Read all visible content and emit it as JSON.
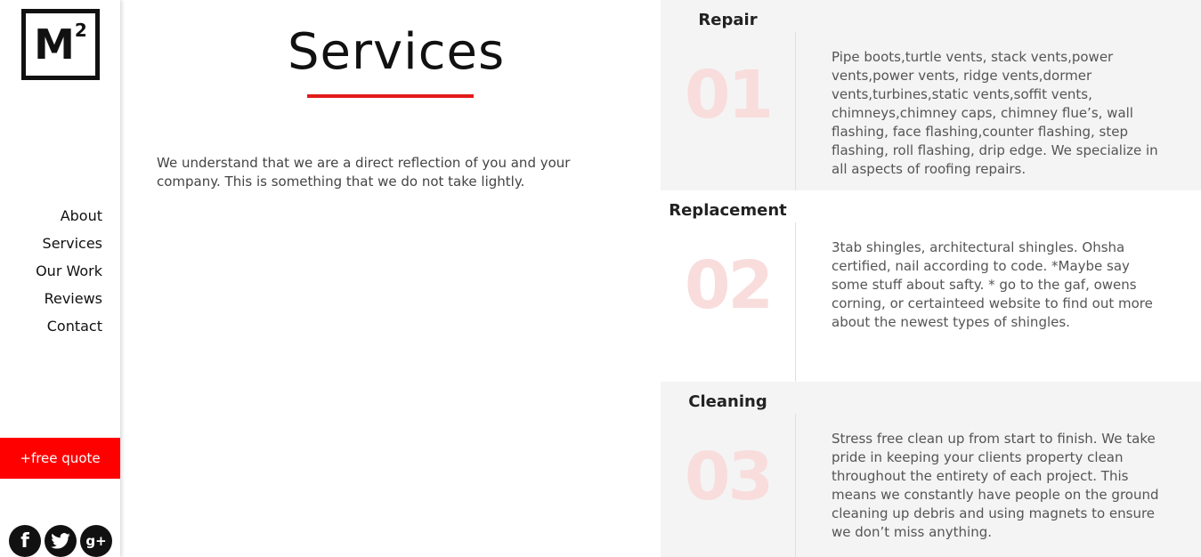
{
  "logo": {
    "main": "M",
    "sup": "2"
  },
  "nav": {
    "items": [
      {
        "label": "About"
      },
      {
        "label": "Services"
      },
      {
        "label": "Our Work"
      },
      {
        "label": "Reviews"
      },
      {
        "label": "Contact"
      }
    ]
  },
  "quote_button": {
    "label": "+free quote"
  },
  "social": [
    {
      "name": "facebook-icon",
      "glyph": "f"
    },
    {
      "name": "twitter-icon",
      "glyph": "t"
    },
    {
      "name": "google-plus-icon",
      "glyph": "g+"
    }
  ],
  "page": {
    "title": "Services",
    "intro": "We understand that we are a direct reflection of you and your company. This is something that we do not take lightly."
  },
  "services": [
    {
      "heading": "Repair",
      "number": "01",
      "text": "Pipe boots,turtle vents, stack vents,power vents,power vents, ridge vents,dormer vents,turbines,static vents,soffit vents, chimneys,chimney caps, chimney flue’s, wall flashing, face flashing,counter flashing, step flashing, roll flashing, drip edge. We specialize in all aspects of roofing repairs."
    },
    {
      "heading": "Replacement",
      "number": "02",
      "text": "3tab shingles, architectural shingles. Ohsha certified, nail according to code. *Maybe say some stuff about safty. * go to the gaf, owens corning, or certainteed website to find out more about the newest types of shingles."
    },
    {
      "heading": "Cleaning",
      "number": "03",
      "text": "Stress free clean up from start to finish. We take pride in keeping your clients property clean throughout the entirety of each project. This means we constantly have people on the ground cleaning up debris and using magnets to ensure we don’t miss anything."
    }
  ],
  "colors": {
    "accent": "#ff0000",
    "underline": "#e21b1b",
    "number_watermark": "#f9dcdc",
    "panel_gray": "#f4f4f4"
  }
}
